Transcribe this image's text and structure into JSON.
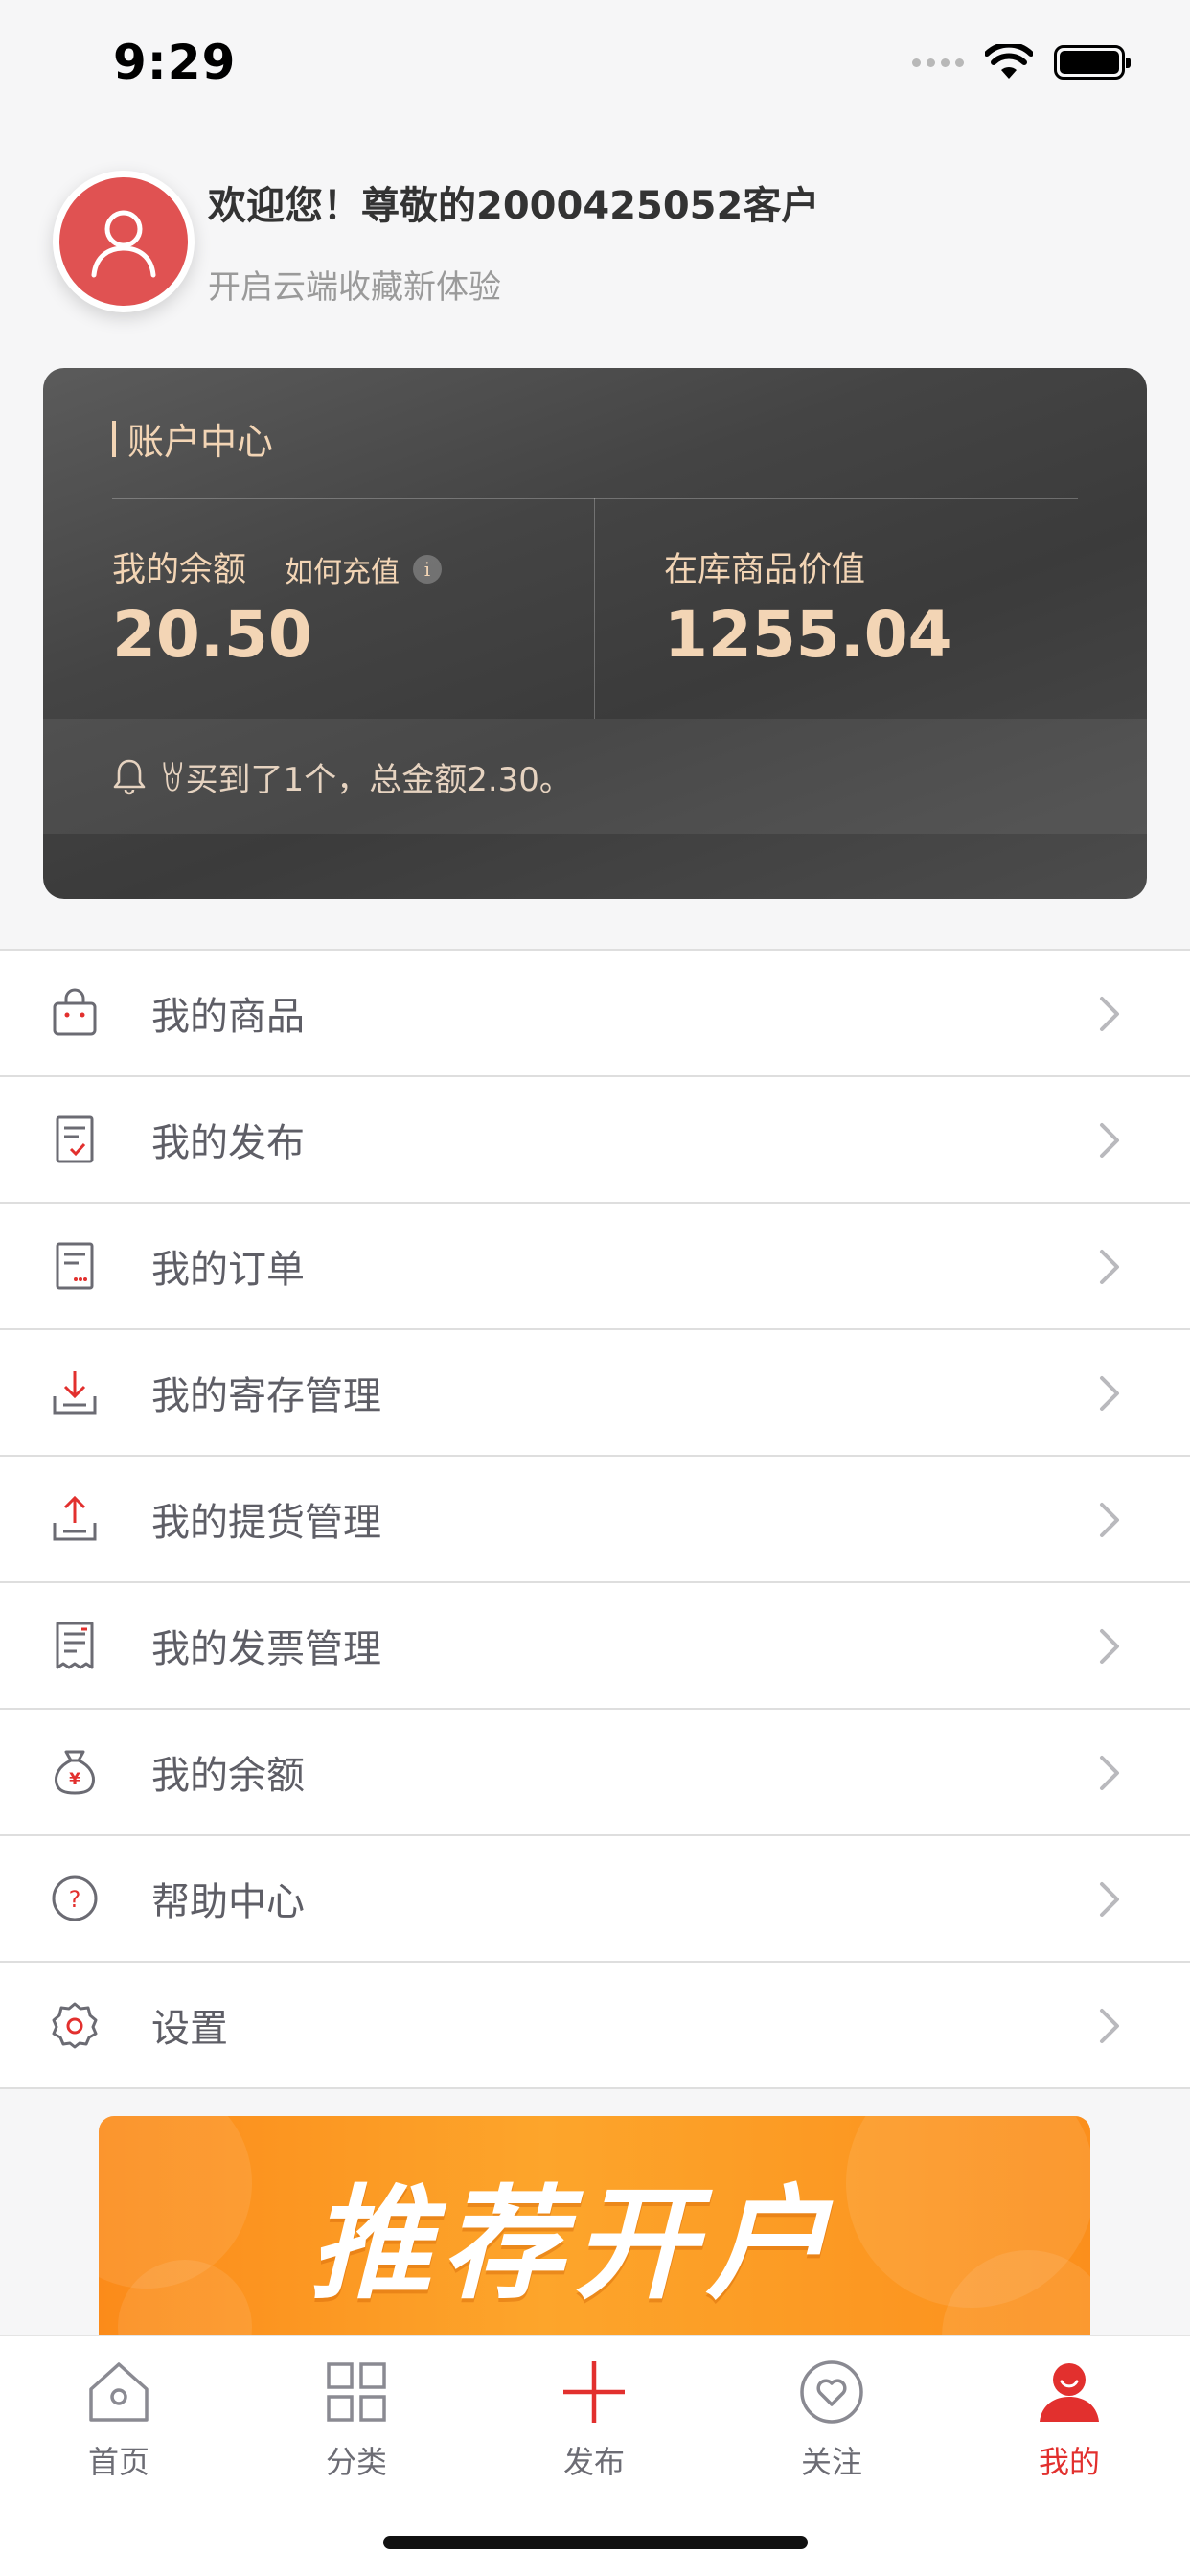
{
  "status_bar": {
    "time": "9:29"
  },
  "profile": {
    "welcome": "欢迎您！尊敬的2000425052客户",
    "subtitle": "开启云端收藏新体验"
  },
  "account_card": {
    "title": "账户中心",
    "balance_label": "我的余额",
    "recharge_link": "如何充值",
    "balance_value": "20.50",
    "stock_label": "在库商品价值",
    "stock_value": "1255.04",
    "notice": "ꇐ买到了1个，总金额2.30。"
  },
  "menu": {
    "items": [
      {
        "label": "我的商品",
        "icon": "shopping-bag-icon"
      },
      {
        "label": "我的发布",
        "icon": "publish-doc-icon"
      },
      {
        "label": "我的订单",
        "icon": "order-doc-icon"
      },
      {
        "label": "我的寄存管理",
        "icon": "deposit-download-icon"
      },
      {
        "label": "我的提货管理",
        "icon": "pickup-upload-icon"
      },
      {
        "label": "我的发票管理",
        "icon": "invoice-receipt-icon"
      },
      {
        "label": "我的余额",
        "icon": "money-bag-icon"
      },
      {
        "label": "帮助中心",
        "icon": "help-circle-icon"
      },
      {
        "label": "设置",
        "icon": "settings-gear-icon"
      }
    ]
  },
  "banner": {
    "text": "推荐开户"
  },
  "tabbar": {
    "tabs": [
      {
        "label": "首页",
        "icon": "home-icon",
        "active": false
      },
      {
        "label": "分类",
        "icon": "grid-icon",
        "active": false
      },
      {
        "label": "发布",
        "icon": "plus-icon",
        "active": false
      },
      {
        "label": "关注",
        "icon": "heart-circle-icon",
        "active": false
      },
      {
        "label": "我的",
        "icon": "user-icon",
        "active": true
      }
    ]
  },
  "colors": {
    "accent": "#e2302e",
    "card_gold": "#f3d5b5",
    "banner_orange": "#fb8b1a"
  }
}
